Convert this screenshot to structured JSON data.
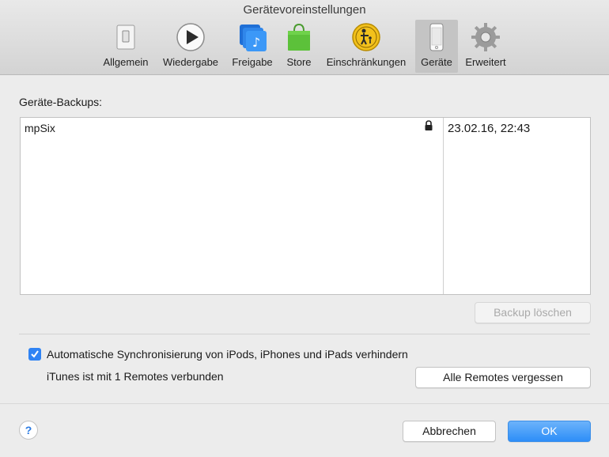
{
  "window": {
    "title": "Gerätevoreinstellungen"
  },
  "toolbar": {
    "items": [
      {
        "label": "Allgemein",
        "icon": "switch-icon"
      },
      {
        "label": "Wiedergabe",
        "icon": "play-icon"
      },
      {
        "label": "Freigabe",
        "icon": "music-share-icon"
      },
      {
        "label": "Store",
        "icon": "shopping-bag-icon"
      },
      {
        "label": "Einschränkungen",
        "icon": "parental-controls-icon"
      },
      {
        "label": "Geräte",
        "icon": "iphone-icon",
        "selected": true
      },
      {
        "label": "Erweitert",
        "icon": "gear-icon"
      }
    ]
  },
  "backups": {
    "section_label": "Geräte-Backups:",
    "rows": [
      {
        "name": "mpSix",
        "date": "23.02.16, 22:43",
        "locked": true
      }
    ],
    "delete_button": "Backup löschen"
  },
  "sync": {
    "checkbox_label": "Automatische Synchronisierung von iPods, iPhones und iPads verhindern",
    "checked": true
  },
  "remotes": {
    "status_text": "iTunes ist mit 1 Remotes verbunden",
    "forget_button": "Alle Remotes vergessen"
  },
  "footer": {
    "help_label": "?",
    "cancel_button": "Abbrechen",
    "ok_button": "OK"
  },
  "colors": {
    "accent": "#2f83f4",
    "primary_button": "#2d8ef8"
  }
}
